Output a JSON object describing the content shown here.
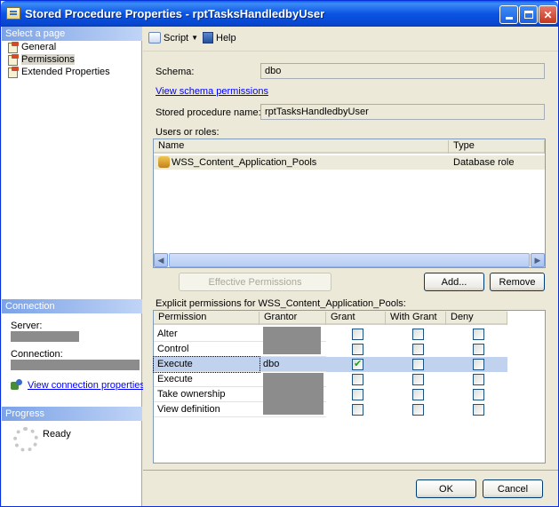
{
  "window": {
    "title": "Stored Procedure Properties - rptTasksHandledbyUser"
  },
  "left": {
    "select_page_header": "Select a page",
    "pages": [
      {
        "label": "General"
      },
      {
        "label": "Permissions",
        "selected": true
      },
      {
        "label": "Extended Properties"
      }
    ],
    "connection_header": "Connection",
    "server_label": "Server:",
    "connection_label": "Connection:",
    "view_connection_properties": "View connection properties",
    "progress_header": "Progress",
    "progress_status": "Ready"
  },
  "toolbar": {
    "script_label": "Script",
    "help_label": "Help"
  },
  "main": {
    "schema_label": "Schema:",
    "schema_value": "dbo",
    "view_schema_permissions": "View schema permissions",
    "sp_name_label": "Stored procedure name:",
    "sp_name_value": "rptTasksHandledbyUser",
    "users_roles_label": "Users or roles:",
    "users_columns": [
      "Name",
      "Type"
    ],
    "users_rows": [
      {
        "name": "WSS_Content_Application_Pools",
        "type": "Database role"
      }
    ],
    "effective_permissions_button": "Effective Permissions",
    "add_button": "Add...",
    "remove_button": "Remove",
    "explicit_label": "Explicit permissions for WSS_Content_Application_Pools:",
    "perm_columns": [
      "Permission",
      "Grantor",
      "Grant",
      "With Grant",
      "Deny"
    ],
    "perm_rows": [
      {
        "permission": "Alter",
        "grantor": "",
        "grant": false,
        "with_grant": false,
        "deny": false
      },
      {
        "permission": "Control",
        "grantor": "",
        "grant": false,
        "with_grant": false,
        "deny": false
      },
      {
        "permission": "Execute",
        "grantor": "dbo",
        "grant": true,
        "with_grant": false,
        "deny": false,
        "selected": true
      },
      {
        "permission": "Execute",
        "grantor": "",
        "grant": false,
        "with_grant": false,
        "deny": false
      },
      {
        "permission": "Take ownership",
        "grantor": "",
        "grant": false,
        "with_grant": false,
        "deny": false
      },
      {
        "permission": "View definition",
        "grantor": "",
        "grant": false,
        "with_grant": false,
        "deny": false
      }
    ]
  },
  "footer": {
    "ok_button": "OK",
    "cancel_button": "Cancel"
  }
}
